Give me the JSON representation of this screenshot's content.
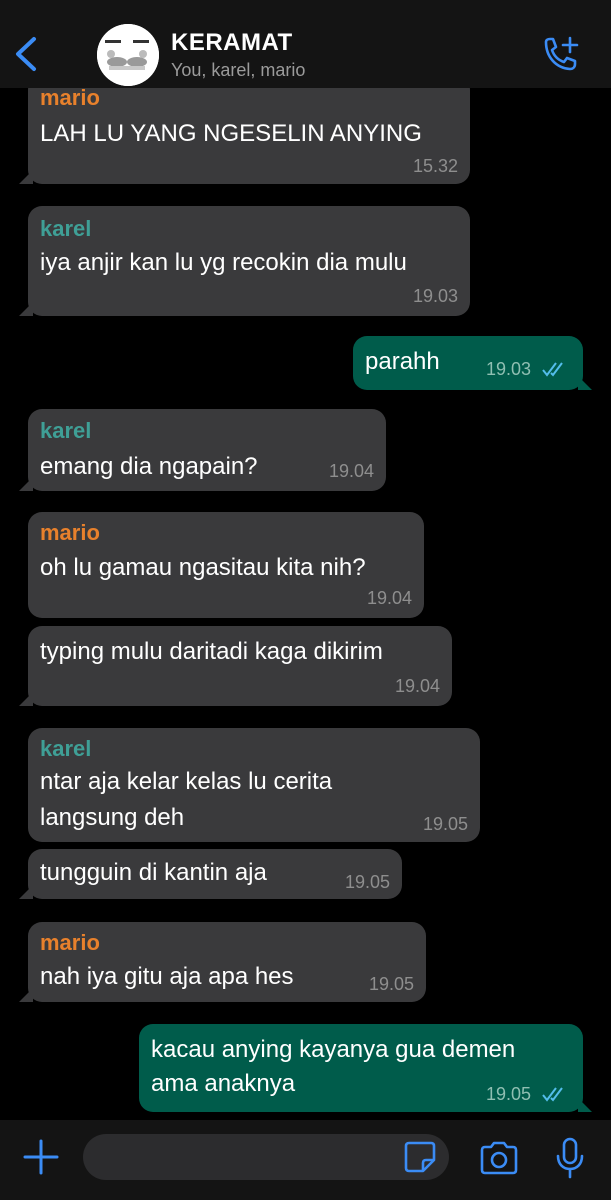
{
  "header": {
    "title": "KERAMAT",
    "subtitle": "You, karel, mario",
    "back_icon": "chevron-left-icon",
    "call_icon": "add-call-icon",
    "accent_color": "#3b8cf5"
  },
  "colors": {
    "mario": "#e8812c",
    "karel": "#3f9f96",
    "incoming_bubble": "#3a3a3c",
    "outgoing_bubble": "#005c4b",
    "read_ticks": "#53bdeb"
  },
  "messages": [
    {
      "sender": "mario",
      "text": "LAH LU YANG NGESELIN ANYING",
      "time": "15.32",
      "direction": "in"
    },
    {
      "sender": "karel",
      "text": "iya anjir kan lu yg recokin dia mulu",
      "time": "19.03",
      "direction": "in"
    },
    {
      "text": "parahh",
      "time": "19.03",
      "direction": "out",
      "status": "read"
    },
    {
      "sender": "karel",
      "text": "emang dia ngapain?",
      "time": "19.04",
      "direction": "in"
    },
    {
      "sender": "mario",
      "text": "oh lu gamau ngasitau kita nih?",
      "time": "19.04",
      "direction": "in"
    },
    {
      "text": "typing mulu daritadi kaga dikirim",
      "time": "19.04",
      "direction": "in"
    },
    {
      "sender": "karel",
      "text_line1": "ntar aja kelar kelas lu cerita",
      "text_line2": "langsung deh",
      "time": "19.05",
      "direction": "in"
    },
    {
      "text": "tungguin di kantin aja",
      "time": "19.05",
      "direction": "in"
    },
    {
      "sender": "mario",
      "text": "nah iya gitu aja apa hes",
      "time": "19.05",
      "direction": "in"
    },
    {
      "text_line1": "kacau anying kayanya gua demen",
      "text_line2": "ama anaknya",
      "time": "19.05",
      "direction": "out",
      "status": "read"
    }
  ],
  "footer": {
    "icons": [
      "plus-icon",
      "sticker-icon",
      "camera-icon",
      "microphone-icon"
    ]
  }
}
